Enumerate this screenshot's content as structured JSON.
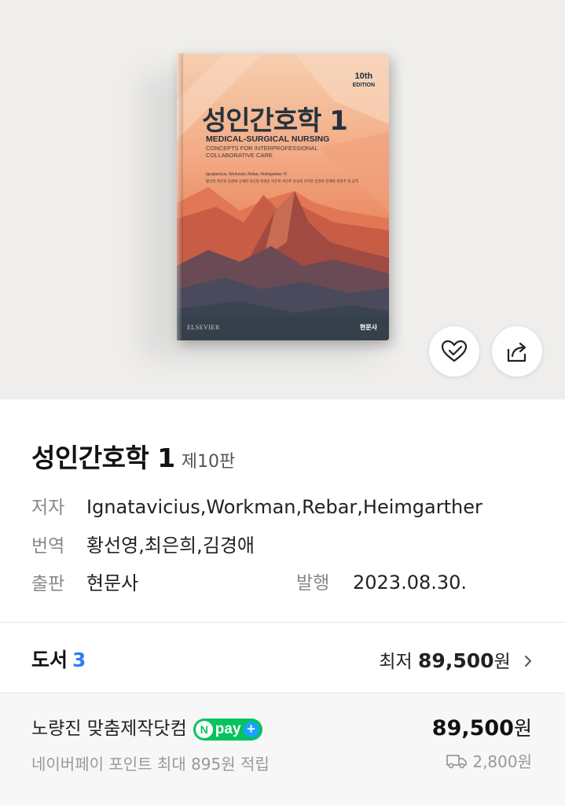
{
  "cover": {
    "edition_number": "10th",
    "edition_label": "EDITION",
    "title": "성인간호학 1",
    "subtitle": "MEDICAL-SURGICAL NURSING",
    "subtitle2": "CONCEPTS FOR INTERPROFESSIONAL COLLABORATIVE CARE",
    "authors": "Ignatavicius, Workman, Rebar, Heimgartner 저",
    "translators": "황선영 최은희 김경애 심재현 김신정 박경순 박은희 서인주 유성희 이지현 임경희 전혜정 정현주 외 공역",
    "publisher_left": "ELSEVIER",
    "publisher_right": "현문사"
  },
  "actions": {
    "like_icon": "heart-check-icon",
    "share_icon": "share-icon"
  },
  "book": {
    "title": "성인간호학 1",
    "edition": "제10판",
    "author_label": "저자",
    "author": "Ignatavicius,Workman,Rebar,Heimgarther",
    "translator_label": "번역",
    "translator": "황선영,최은희,김경애",
    "publisher_label": "출판",
    "publisher": "현문사",
    "issue_label": "발행",
    "issue_date": "2023.08.30."
  },
  "listing": {
    "label": "도서",
    "count": "3",
    "lowest_label": "최저",
    "lowest_price": "89,500",
    "currency": "원"
  },
  "seller": {
    "name": "노량진 맞춤제작닷컴",
    "npay_label": "pay",
    "price": "89,500",
    "currency": "원",
    "points": "네이버페이 포인트 최대 895원 적립",
    "shipping_fee": "2,800원"
  },
  "colors": {
    "accent_blue": "#2f7cf6",
    "npay_green": "#06c35e",
    "hero_bg": "#efeeec"
  }
}
